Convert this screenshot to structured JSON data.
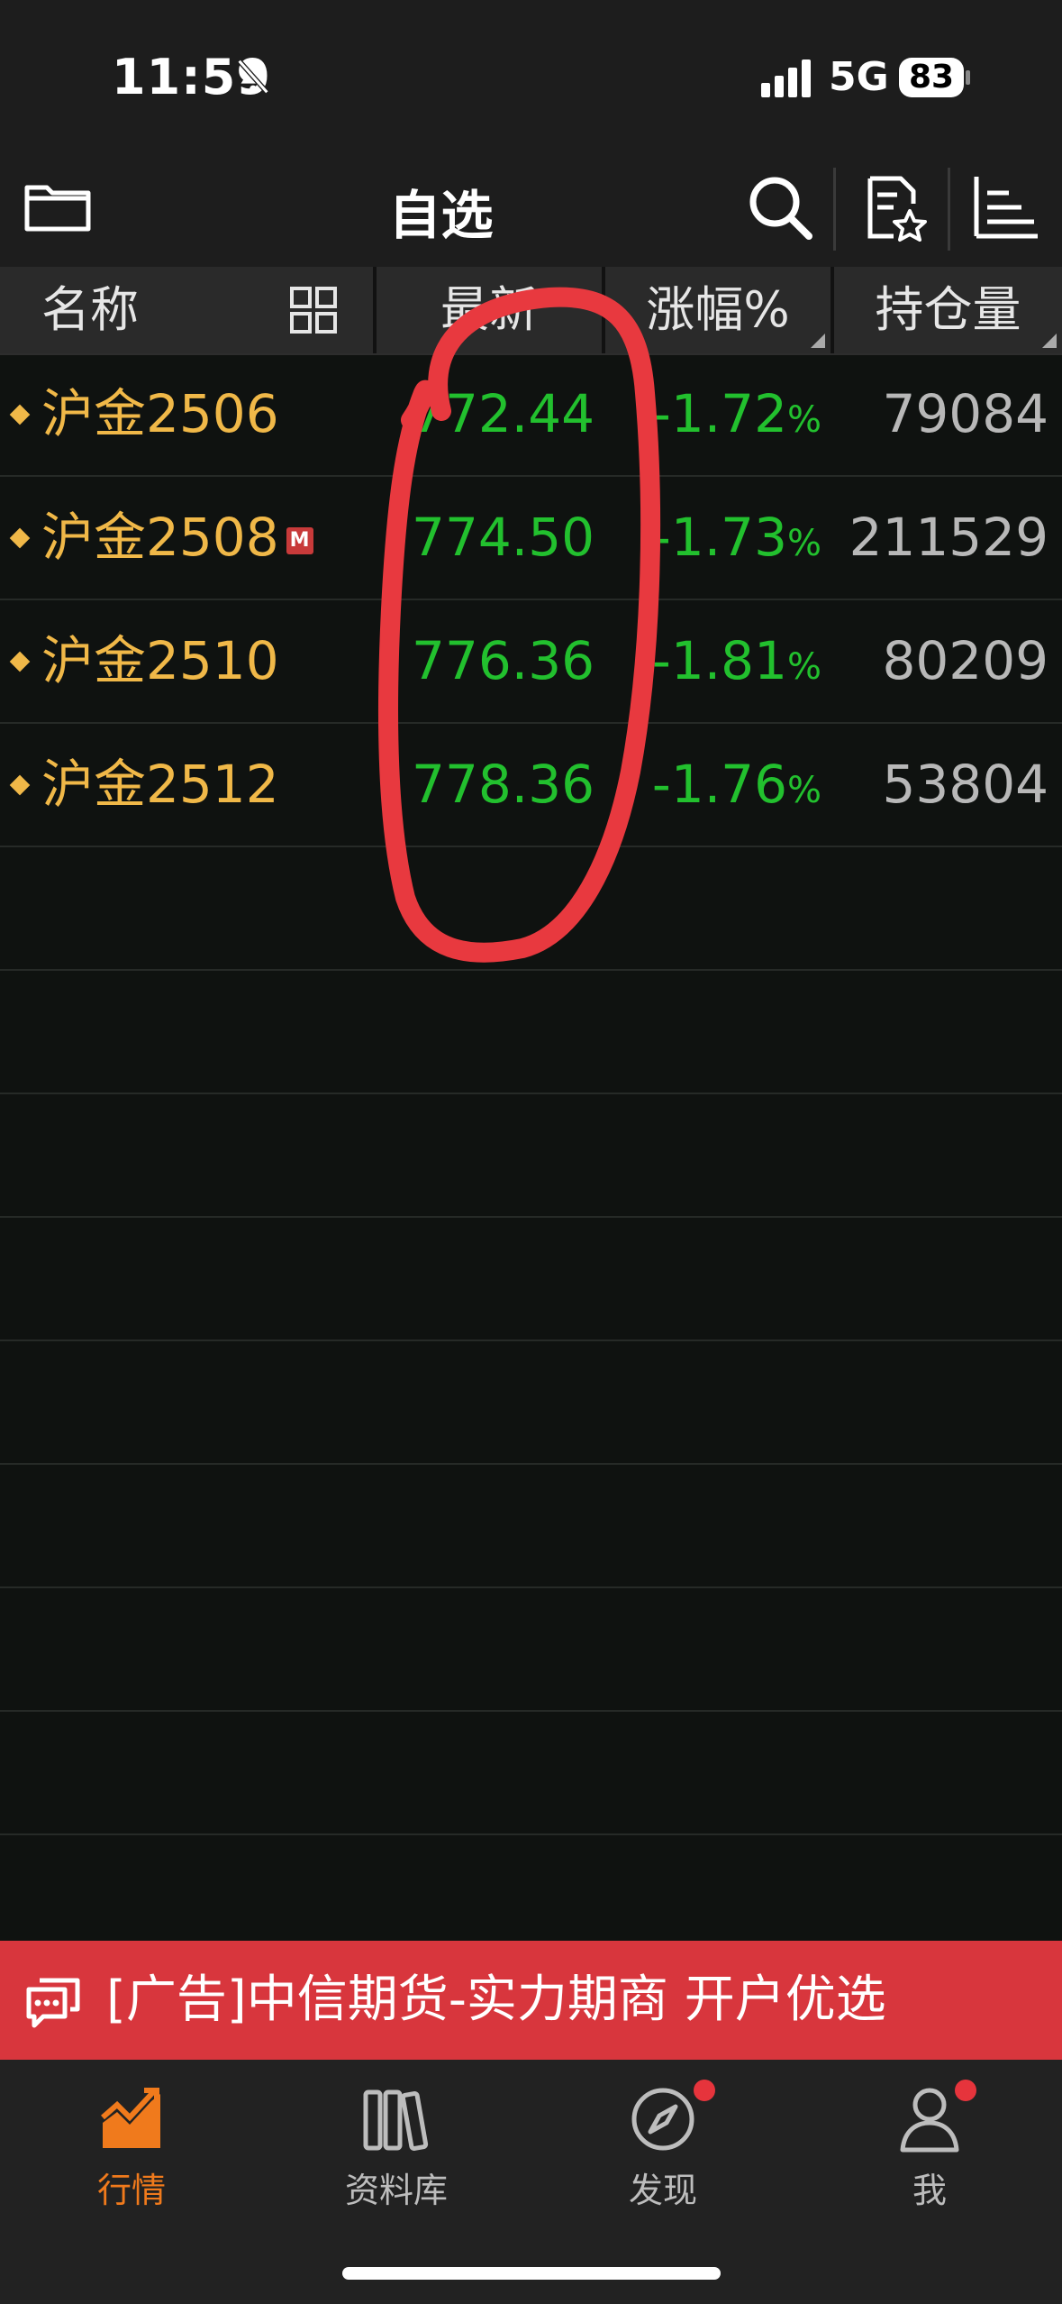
{
  "status_bar": {
    "time": "11:59",
    "network": "5G",
    "battery": "83"
  },
  "nav": {
    "title": "自选"
  },
  "table": {
    "headers": {
      "name": "名称",
      "latest": "最新",
      "change": "涨幅%",
      "open_interest": "持仓量"
    },
    "rows": [
      {
        "name": "沪金2506",
        "badge": "",
        "price": "772.44",
        "change": "-1.72",
        "pct": "%",
        "open_interest": "79084"
      },
      {
        "name": "沪金2508",
        "badge": "M",
        "price": "774.50",
        "change": "-1.73",
        "pct": "%",
        "open_interest": "211529"
      },
      {
        "name": "沪金2510",
        "badge": "",
        "price": "776.36",
        "change": "-1.81",
        "pct": "%",
        "open_interest": "80209"
      },
      {
        "name": "沪金2512",
        "badge": "",
        "price": "778.36",
        "change": "-1.76",
        "pct": "%",
        "open_interest": "53804"
      }
    ]
  },
  "ad": {
    "text": "[广告]中信期货-实力期商 开户优选"
  },
  "tabs": [
    {
      "label": "行情",
      "icon": "chart-trend-icon",
      "active": true
    },
    {
      "label": "资料库",
      "icon": "books-icon",
      "active": false
    },
    {
      "label": "发现",
      "icon": "compass-icon",
      "active": false
    },
    {
      "label": "我",
      "icon": "user-icon",
      "active": false
    }
  ],
  "colors": {
    "up_down_green": "#22c02e",
    "name_gold": "#f0b848",
    "ad_red": "#d8363d",
    "active_orange": "#f07a1c"
  }
}
